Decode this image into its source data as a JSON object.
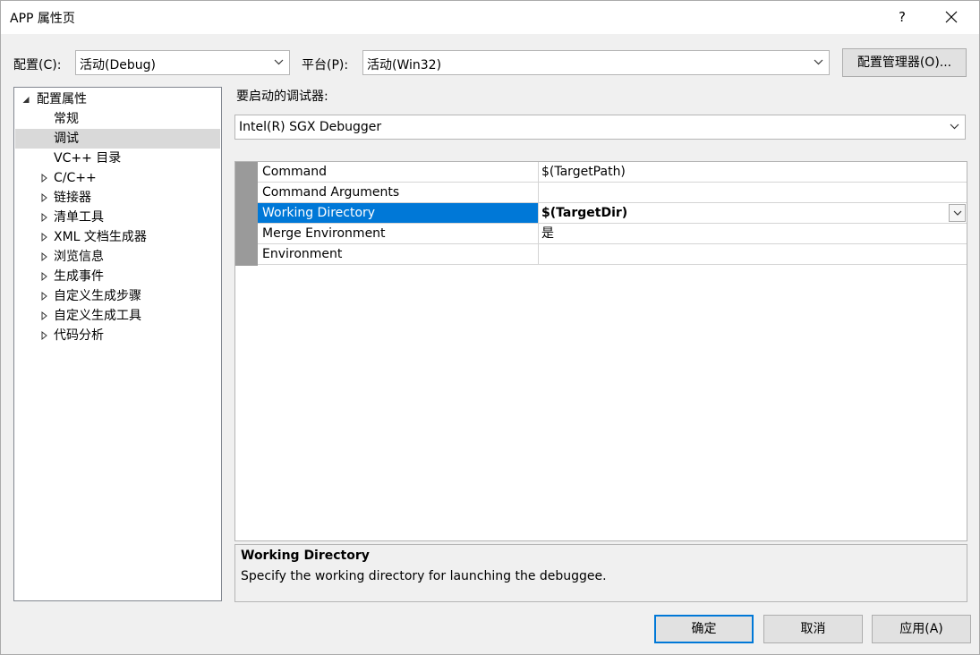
{
  "window": {
    "title": "APP 属性页",
    "help": "?"
  },
  "toolbar": {
    "config_label": "配置(C):",
    "config_value": "活动(Debug)",
    "platform_label": "平台(P):",
    "platform_value": "活动(Win32)",
    "config_manager": "配置管理器(O)..."
  },
  "tree": {
    "root": "配置属性",
    "items": [
      {
        "label": "常规",
        "expandable": false
      },
      {
        "label": "调试",
        "expandable": false,
        "selected": true
      },
      {
        "label": "VC++ 目录",
        "expandable": false
      },
      {
        "label": "C/C++",
        "expandable": true
      },
      {
        "label": "链接器",
        "expandable": true
      },
      {
        "label": "清单工具",
        "expandable": true
      },
      {
        "label": "XML 文档生成器",
        "expandable": true
      },
      {
        "label": "浏览信息",
        "expandable": true
      },
      {
        "label": "生成事件",
        "expandable": true
      },
      {
        "label": "自定义生成步骤",
        "expandable": true
      },
      {
        "label": "自定义生成工具",
        "expandable": true
      },
      {
        "label": "代码分析",
        "expandable": true
      }
    ]
  },
  "debugger": {
    "label": "要启动的调试器:",
    "value": "Intel(R) SGX Debugger"
  },
  "grid": {
    "rows": [
      {
        "name": "Command",
        "value": "$(TargetPath)"
      },
      {
        "name": "Command Arguments",
        "value": ""
      },
      {
        "name": "Working Directory",
        "value": "$(TargetDir)",
        "selected": true
      },
      {
        "name": "Merge Environment",
        "value": "是"
      },
      {
        "name": "Environment",
        "value": ""
      }
    ]
  },
  "description": {
    "title": "Working Directory",
    "text": "Specify the working directory for launching the debuggee."
  },
  "buttons": {
    "ok": "确定",
    "cancel": "取消",
    "apply": "应用(A)"
  },
  "colors": {
    "selection": "#0078d7",
    "tree_selection": "#d9d9d9",
    "gutter": "#9a9a9a"
  }
}
